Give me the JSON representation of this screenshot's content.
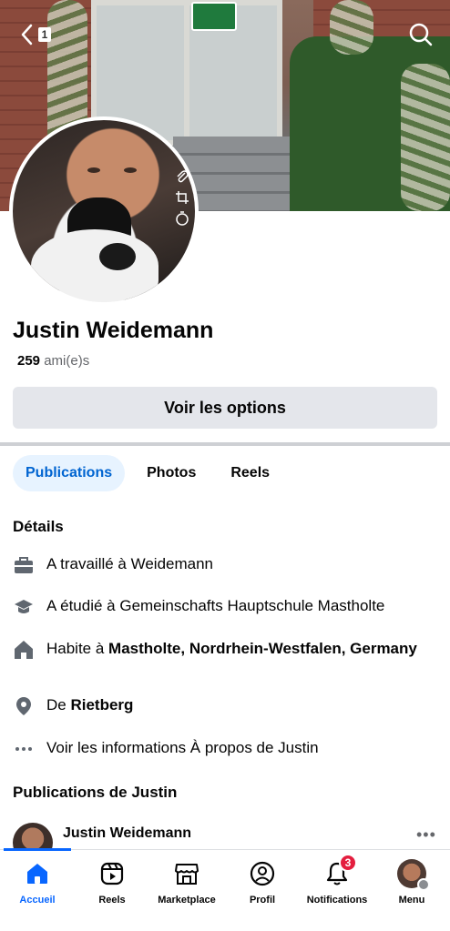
{
  "header": {
    "back_count": "1"
  },
  "profile": {
    "name": "Justin Weidemann",
    "friends_count": "259",
    "friends_label": "ami(e)s",
    "options_button": "Voir les options"
  },
  "tabs": [
    {
      "label": "Publications",
      "active": true
    },
    {
      "label": "Photos",
      "active": false
    },
    {
      "label": "Reels",
      "active": false
    }
  ],
  "details": {
    "title": "Détails",
    "work": "A travaillé à Weidemann",
    "education": "A étudié à Gemeinschafts Hauptschule Mastholte",
    "lives_prefix": "Habite à ",
    "lives_place": "Mastholte, Nordrhein-Westfalen, Germany",
    "from_prefix": "De ",
    "from_place": "Rietberg",
    "about_link": "Voir les informations À propos de Justin"
  },
  "posts": {
    "title": "Publications de Justin",
    "first_post_author": "Justin Weidemann",
    "more": "•••"
  },
  "bottom_nav": {
    "home": "Accueil",
    "reels": "Reels",
    "marketplace": "Marketplace",
    "profile": "Profil",
    "notifications": "Notifications",
    "notifications_badge": "3",
    "menu": "Menu"
  },
  "colors": {
    "accent": "#0866ff",
    "tab_active_bg": "#e7f3ff",
    "button_bg": "#e4e6eb",
    "badge_red": "#e41e3f"
  },
  "icons": {
    "back": "chevron-left-icon",
    "search": "search-icon",
    "work": "briefcase-icon",
    "education": "graduation-cap-icon",
    "home": "house-icon",
    "location": "location-pin-icon",
    "more": "more-dots-icon"
  }
}
